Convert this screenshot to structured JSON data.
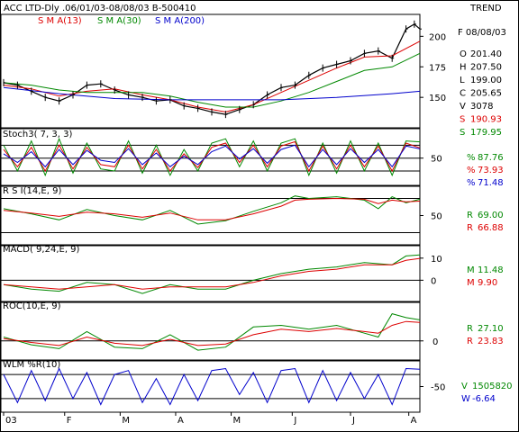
{
  "header": {
    "title": "ACC LTD-Dly .06/01/03-08/08/03  B-500410",
    "trend_label": "TREND",
    "date": "F 08/08/03"
  },
  "colors": {
    "price": "#000000",
    "sma13": "#dd0000",
    "sma30": "#008800",
    "sma200": "#0000cc",
    "green": "#008800",
    "red": "#dd0000",
    "blue": "#0000cc"
  },
  "chart_data": [
    {
      "type": "line",
      "panel": "price",
      "title": "ACC LTD-Dly .06/01/03-08/08/03  B-500410",
      "legend": [
        "S M A(13)",
        "S M A(30)",
        "S M A(200)"
      ],
      "y_ticks": [
        200,
        175,
        150
      ],
      "ylim": [
        128,
        215
      ],
      "x_ticks": [
        "03",
        "F",
        "M",
        "A",
        "M",
        "J",
        "J",
        "A"
      ],
      "x_tick_pos": [
        0,
        22,
        42,
        62,
        82,
        104,
        125,
        146
      ],
      "n": 151,
      "readout": [
        {
          "key": "O",
          "value": "201.40",
          "color": "#000000"
        },
        {
          "key": "H",
          "value": "207.50",
          "color": "#000000"
        },
        {
          "key": "L",
          "value": "199.00",
          "color": "#000000"
        },
        {
          "key": "C",
          "value": "205.65",
          "color": "#000000"
        },
        {
          "key": "V",
          "value": "3078",
          "color": "#000000"
        },
        {
          "key": "S",
          "value": "190.93",
          "color": "#dd0000"
        },
        {
          "key": "S",
          "value": "179.95",
          "color": "#008800"
        }
      ],
      "series": [
        {
          "name": "Price",
          "color": "#000000",
          "x": [
            0,
            5,
            10,
            15,
            20,
            25,
            30,
            35,
            40,
            45,
            50,
            55,
            60,
            65,
            70,
            75,
            80,
            85,
            90,
            95,
            100,
            105,
            110,
            115,
            120,
            125,
            130,
            135,
            140,
            145,
            148,
            150
          ],
          "values": [
            162,
            160,
            155,
            150,
            147,
            152,
            160,
            161,
            156,
            152,
            150,
            147,
            148,
            143,
            141,
            138,
            136,
            140,
            144,
            152,
            158,
            160,
            168,
            174,
            177,
            180,
            186,
            188,
            182,
            206,
            210,
            206
          ]
        },
        {
          "name": "S M A(13)",
          "color": "#dd0000",
          "x": [
            0,
            10,
            20,
            30,
            40,
            50,
            60,
            70,
            80,
            90,
            100,
            110,
            120,
            130,
            140,
            150
          ],
          "values": [
            160,
            157,
            151,
            155,
            157,
            152,
            148,
            142,
            138,
            144,
            154,
            164,
            174,
            183,
            184,
            196
          ]
        },
        {
          "name": "S M A(30)",
          "color": "#008800",
          "x": [
            0,
            10,
            20,
            30,
            40,
            50,
            60,
            70,
            80,
            90,
            100,
            110,
            120,
            130,
            140,
            150
          ],
          "values": [
            162,
            160,
            156,
            154,
            154,
            154,
            151,
            146,
            142,
            142,
            147,
            154,
            163,
            172,
            175,
            186
          ]
        },
        {
          "name": "S M A(200)",
          "color": "#0000cc",
          "x": [
            0,
            20,
            40,
            60,
            80,
            100,
            120,
            140,
            150
          ],
          "values": [
            158,
            153,
            149,
            148,
            148,
            148,
            150,
            153,
            155
          ]
        }
      ]
    },
    {
      "type": "line",
      "panel": "stoch",
      "title": "Stoch3( 7, 3, 3)",
      "y_ticks": [
        50
      ],
      "ylim": [
        -5,
        110
      ],
      "n": 151,
      "readout": [
        {
          "key": "%",
          "value": "87.76",
          "color": "#008800"
        },
        {
          "key": "%",
          "value": "73.93",
          "color": "#dd0000"
        },
        {
          "key": "%",
          "value": "71.48",
          "color": "#0000cc"
        }
      ],
      "series": [
        {
          "name": "%",
          "color": "#008800",
          "x": [
            0,
            5,
            10,
            15,
            20,
            25,
            30,
            35,
            40,
            45,
            50,
            55,
            60,
            65,
            70,
            75,
            80,
            85,
            90,
            95,
            100,
            105,
            110,
            115,
            120,
            125,
            130,
            135,
            140,
            145,
            150
          ],
          "values": [
            80,
            20,
            90,
            10,
            95,
            15,
            85,
            25,
            20,
            90,
            15,
            80,
            10,
            70,
            20,
            85,
            95,
            30,
            90,
            20,
            85,
            95,
            10,
            85,
            15,
            90,
            20,
            85,
            10,
            90,
            87.76
          ]
        },
        {
          "name": "%",
          "color": "#dd0000",
          "x": [
            0,
            5,
            10,
            15,
            20,
            25,
            30,
            35,
            40,
            45,
            50,
            55,
            60,
            65,
            70,
            75,
            80,
            85,
            90,
            95,
            100,
            105,
            110,
            115,
            120,
            125,
            130,
            135,
            140,
            145,
            150
          ],
          "values": [
            70,
            30,
            75,
            20,
            80,
            25,
            75,
            35,
            30,
            80,
            25,
            70,
            20,
            60,
            28,
            75,
            85,
            40,
            80,
            30,
            78,
            88,
            20,
            78,
            25,
            80,
            30,
            78,
            20,
            85,
            73.93
          ]
        },
        {
          "name": "%",
          "color": "#0000cc",
          "x": [
            0,
            5,
            10,
            15,
            20,
            25,
            30,
            35,
            40,
            45,
            50,
            55,
            60,
            65,
            70,
            75,
            80,
            85,
            90,
            95,
            100,
            105,
            110,
            115,
            120,
            125,
            130,
            135,
            140,
            145,
            150
          ],
          "values": [
            60,
            40,
            65,
            30,
            70,
            35,
            68,
            45,
            40,
            72,
            35,
            62,
            30,
            55,
            35,
            65,
            78,
            48,
            72,
            38,
            70,
            80,
            30,
            70,
            35,
            72,
            40,
            70,
            30,
            78,
            71.48
          ]
        }
      ]
    },
    {
      "type": "line",
      "panel": "rsi",
      "title": "R S I(14,E, 9)",
      "y_ticks": [
        50
      ],
      "ylim": [
        20,
        80
      ],
      "n": 151,
      "readout": [
        {
          "key": "R",
          "value": "69.00",
          "color": "#008800"
        },
        {
          "key": "R",
          "value": "66.88",
          "color": "#dd0000"
        }
      ],
      "series": [
        {
          "name": "R",
          "color": "#008800",
          "x": [
            0,
            10,
            20,
            30,
            40,
            50,
            60,
            70,
            80,
            90,
            100,
            105,
            110,
            120,
            130,
            135,
            140,
            145,
            150
          ],
          "values": [
            58,
            52,
            45,
            57,
            50,
            45,
            56,
            40,
            44,
            55,
            65,
            73,
            70,
            72,
            68,
            58,
            72,
            65,
            69
          ]
        },
        {
          "name": "R",
          "color": "#dd0000",
          "x": [
            0,
            10,
            20,
            30,
            40,
            50,
            60,
            70,
            80,
            90,
            100,
            105,
            110,
            120,
            130,
            135,
            140,
            145,
            150
          ],
          "values": [
            56,
            53,
            49,
            54,
            52,
            48,
            53,
            45,
            45,
            52,
            61,
            68,
            69,
            70,
            69,
            64,
            68,
            66,
            66.88
          ]
        }
      ]
    },
    {
      "type": "line",
      "panel": "macd",
      "title": "MACD( 9,24,E, 9)",
      "y_ticks": [
        10,
        0
      ],
      "ylim": [
        -8,
        14
      ],
      "n": 151,
      "readout": [
        {
          "key": "M",
          "value": "11.48",
          "color": "#008800"
        },
        {
          "key": "M",
          "value": "9.90",
          "color": "#dd0000"
        }
      ],
      "series": [
        {
          "name": "M",
          "color": "#008800",
          "x": [
            0,
            10,
            20,
            30,
            40,
            50,
            60,
            70,
            80,
            90,
            100,
            110,
            120,
            130,
            140,
            145,
            150
          ],
          "values": [
            -2,
            -4,
            -5,
            -1,
            -2,
            -6,
            -2,
            -4,
            -4,
            0,
            3,
            5,
            6,
            8,
            7,
            11,
            11.48
          ]
        },
        {
          "name": "M",
          "color": "#dd0000",
          "x": [
            0,
            10,
            20,
            30,
            40,
            50,
            60,
            70,
            80,
            90,
            100,
            110,
            120,
            130,
            140,
            145,
            150
          ],
          "values": [
            -2,
            -3,
            -4,
            -3,
            -2,
            -4,
            -3,
            -3,
            -3,
            -1,
            2,
            4,
            5,
            7,
            7,
            9,
            9.9
          ]
        }
      ]
    },
    {
      "type": "line",
      "panel": "roc",
      "title": "ROC(10,E, 9)",
      "y_ticks": [
        0
      ],
      "ylim": [
        -20,
        45
      ],
      "n": 151,
      "readout": [
        {
          "key": "R",
          "value": "27.10",
          "color": "#008800"
        },
        {
          "key": "R",
          "value": "23.83",
          "color": "#dd0000"
        }
      ],
      "series": [
        {
          "name": "R",
          "color": "#008800",
          "x": [
            0,
            10,
            20,
            30,
            40,
            50,
            60,
            70,
            80,
            90,
            100,
            110,
            120,
            130,
            135,
            140,
            145,
            150
          ],
          "values": [
            5,
            -5,
            -10,
            12,
            -8,
            -10,
            8,
            -12,
            -8,
            18,
            20,
            15,
            20,
            10,
            5,
            35,
            30,
            27.1
          ]
        },
        {
          "name": "R",
          "color": "#dd0000",
          "x": [
            0,
            10,
            20,
            30,
            40,
            50,
            60,
            70,
            80,
            90,
            100,
            110,
            120,
            130,
            135,
            140,
            145,
            150
          ],
          "values": [
            3,
            -2,
            -6,
            5,
            -3,
            -6,
            2,
            -6,
            -4,
            8,
            15,
            12,
            16,
            12,
            10,
            20,
            25,
            23.83
          ]
        }
      ]
    },
    {
      "type": "line",
      "panel": "wlm",
      "title": "WLM %R(10)",
      "y_ticks": [
        -50
      ],
      "ylim": [
        -105,
        5
      ],
      "n": 151,
      "readout": [
        {
          "key": "V",
          "value": "1505820",
          "color": "#008800"
        },
        {
          "key": "W",
          "value": "-6.64",
          "color": "#0000cc"
        }
      ],
      "series": [
        {
          "name": "W",
          "color": "#0000cc",
          "x": [
            0,
            5,
            10,
            15,
            20,
            25,
            30,
            35,
            40,
            45,
            50,
            55,
            60,
            65,
            70,
            75,
            80,
            85,
            90,
            95,
            100,
            105,
            110,
            115,
            120,
            125,
            130,
            135,
            140,
            145,
            150
          ],
          "values": [
            -20,
            -90,
            -10,
            -85,
            -5,
            -80,
            -15,
            -95,
            -20,
            -10,
            -90,
            -30,
            -95,
            -20,
            -85,
            -10,
            -5,
            -70,
            -15,
            -90,
            -10,
            -5,
            -90,
            -10,
            -85,
            -15,
            -80,
            -20,
            -95,
            -5,
            -6.64
          ]
        }
      ]
    }
  ]
}
